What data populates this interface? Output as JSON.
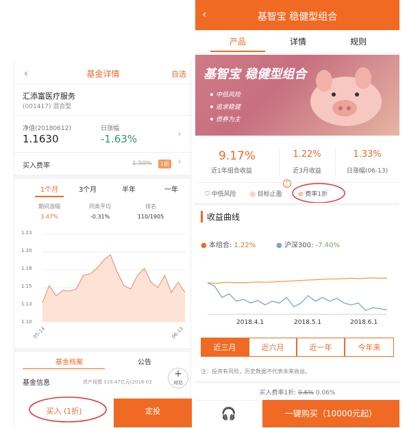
{
  "left": {
    "header": {
      "back": "‹",
      "title": "基金详情",
      "right": "自选"
    },
    "fund": {
      "name": "汇添富医疗服务",
      "code": "(001417) 混合型"
    },
    "nav": {
      "label": "净值(20180612)",
      "value": "1.1630"
    },
    "change": {
      "label": "日涨幅",
      "value": "-1.63%"
    },
    "fee": {
      "label": "买入费率",
      "old": "1.50%",
      "tag": "1折"
    },
    "periods": [
      "1个月",
      "3个月",
      "半年",
      "一年"
    ],
    "stats": {
      "headers": [
        "期间涨幅",
        "同类平均",
        "排名"
      ],
      "values": [
        "3.47%",
        "-0.31%",
        "110/1905"
      ]
    },
    "tabs": {
      "archive": "基金档案",
      "notice": "公告"
    },
    "info": {
      "label": "基金信息",
      "detail": "资产规模 118.47亿元(2018-03",
      "compare": "对比"
    },
    "bottom": {
      "buy": "买入 (1折)",
      "fixed": "定投"
    },
    "colors": {
      "accent": "#f06a24",
      "chart_fill": "#fde2d6",
      "chart_line": "#f0846a"
    }
  },
  "right": {
    "header": {
      "back": "‹",
      "title": "基智宝 稳健型组合"
    },
    "tabs": [
      "产品",
      "详情",
      "规则"
    ],
    "banner": {
      "title": "基智宝 稳健型组合",
      "bullets": [
        "中低风险",
        "追求稳健",
        "债券为主"
      ]
    },
    "returns": [
      {
        "value": "9.17%",
        "label": "近1年组合收益"
      },
      {
        "value": "1.22%",
        "label": "近3月收益"
      },
      {
        "value": "1.33%",
        "label": "日涨幅(06-13)"
      }
    ],
    "tags": [
      "中低风险",
      "目标止盈",
      "费率1折"
    ],
    "section_title": "收益曲线",
    "legend": {
      "mine_label": "本组合:",
      "mine_value": "1.22%",
      "bench_label": "沪深300:",
      "bench_value": "-7.40%"
    },
    "ranges": [
      "近三月",
      "近六月",
      "近一年",
      "今年来"
    ],
    "note": "注：投资有风险，历史数据不代表未来收益。",
    "fee": {
      "label": "买入费率1折:",
      "old": "0.6%",
      "new": "0.06%"
    },
    "bottom": {
      "onekey": "一键购买（10000元起）"
    },
    "colors": {
      "accent": "#f06a24",
      "mine": "#f0a23c",
      "bench": "#7ea3cc"
    }
  },
  "chart_data": [
    {
      "type": "area",
      "x": [
        "05-14",
        "06-13"
      ],
      "ylim": [
        1.1,
        1.23
      ],
      "yticks": [
        "1.23",
        "1.20",
        "1.18",
        "1.15",
        "1.13",
        "1.10"
      ],
      "values": [
        1.13,
        1.155,
        1.14,
        1.148,
        1.147,
        1.15,
        1.17,
        1.172,
        1.18,
        1.192,
        1.2,
        1.175,
        1.155,
        1.15,
        1.17,
        1.18,
        1.16,
        1.152,
        1.17,
        1.145,
        1.16,
        1.145
      ]
    },
    {
      "type": "line",
      "x": [
        "2018.4.1",
        "2018.5.1",
        "2018.6.1"
      ],
      "series": [
        {
          "name": "本组合",
          "values": [
            0.0,
            -0.2,
            0.0,
            0.1,
            0.0,
            0.0,
            0.1,
            0.2,
            0.1,
            0.2,
            0.3,
            0.4,
            0.5,
            0.6,
            0.7,
            0.8,
            0.9,
            1.0,
            1.0,
            1.1,
            1.2,
            1.1,
            1.2,
            1.3,
            1.2,
            1.22
          ]
        },
        {
          "name": "沪深300",
          "values": [
            0.0,
            -1.0,
            -4.0,
            -3.0,
            -5.0,
            -4.5,
            -5.5,
            -4.8,
            -6.0,
            -5.0,
            -5.5,
            -4.0,
            -6.5,
            -5.5,
            -3.5,
            -5.0,
            -4.0,
            -5.0,
            -4.2,
            -5.5,
            -6.0,
            -5.5,
            -7.5,
            -6.8,
            -7.0,
            -7.4
          ]
        }
      ]
    }
  ]
}
